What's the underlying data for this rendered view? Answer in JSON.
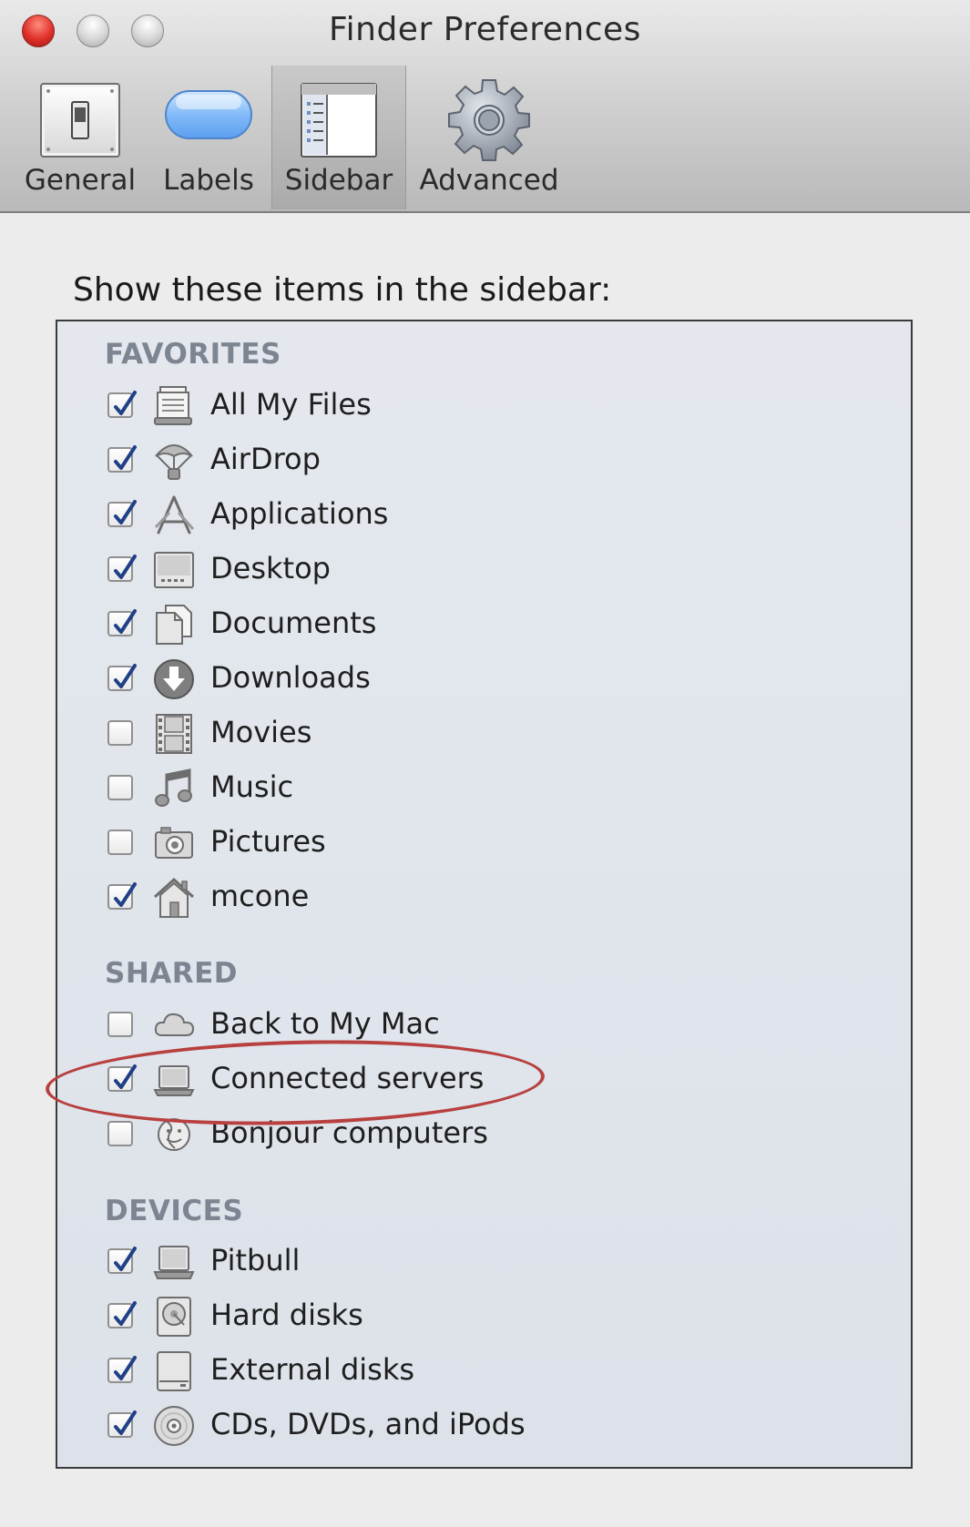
{
  "window": {
    "title": "Finder Preferences"
  },
  "toolbar": {
    "tabs": [
      {
        "label": "General",
        "icon": "general-switch-icon"
      },
      {
        "label": "Labels",
        "icon": "labels-pill-icon"
      },
      {
        "label": "Sidebar",
        "icon": "sidebar-window-icon",
        "selected": true
      },
      {
        "label": "Advanced",
        "icon": "gear-icon"
      }
    ]
  },
  "content": {
    "prompt": "Show these items in the sidebar:",
    "favorites": {
      "heading": "FAVORITES",
      "items": [
        {
          "label": "All My Files",
          "checked": true,
          "icon": "all-my-files-icon"
        },
        {
          "label": "AirDrop",
          "checked": true,
          "icon": "airdrop-icon"
        },
        {
          "label": "Applications",
          "checked": true,
          "icon": "applications-icon"
        },
        {
          "label": "Desktop",
          "checked": true,
          "icon": "desktop-icon"
        },
        {
          "label": "Documents",
          "checked": true,
          "icon": "documents-icon"
        },
        {
          "label": "Downloads",
          "checked": true,
          "icon": "downloads-icon"
        },
        {
          "label": "Movies",
          "checked": false,
          "icon": "movies-icon"
        },
        {
          "label": "Music",
          "checked": false,
          "icon": "music-icon"
        },
        {
          "label": "Pictures",
          "checked": false,
          "icon": "pictures-icon"
        },
        {
          "label": "mcone",
          "checked": true,
          "icon": "home-icon"
        }
      ]
    },
    "shared": {
      "heading": "SHARED",
      "items": [
        {
          "label": "Back to My Mac",
          "checked": false,
          "icon": "cloud-icon"
        },
        {
          "label": "Connected servers",
          "checked": true,
          "icon": "server-icon",
          "highlighted": true
        },
        {
          "label": "Bonjour computers",
          "checked": false,
          "icon": "bonjour-icon"
        }
      ]
    },
    "devices": {
      "heading": "DEVICES",
      "items": [
        {
          "label": "Pitbull",
          "checked": true,
          "icon": "laptop-icon"
        },
        {
          "label": "Hard disks",
          "checked": true,
          "icon": "hard-disk-icon"
        },
        {
          "label": "External disks",
          "checked": true,
          "icon": "external-disk-icon"
        },
        {
          "label": "CDs, DVDs, and iPods",
          "checked": true,
          "icon": "cd-icon"
        }
      ]
    }
  },
  "colors": {
    "highlight_ellipse": "#b8403f",
    "heading": "#7d8592",
    "check": "#1f3f87"
  }
}
